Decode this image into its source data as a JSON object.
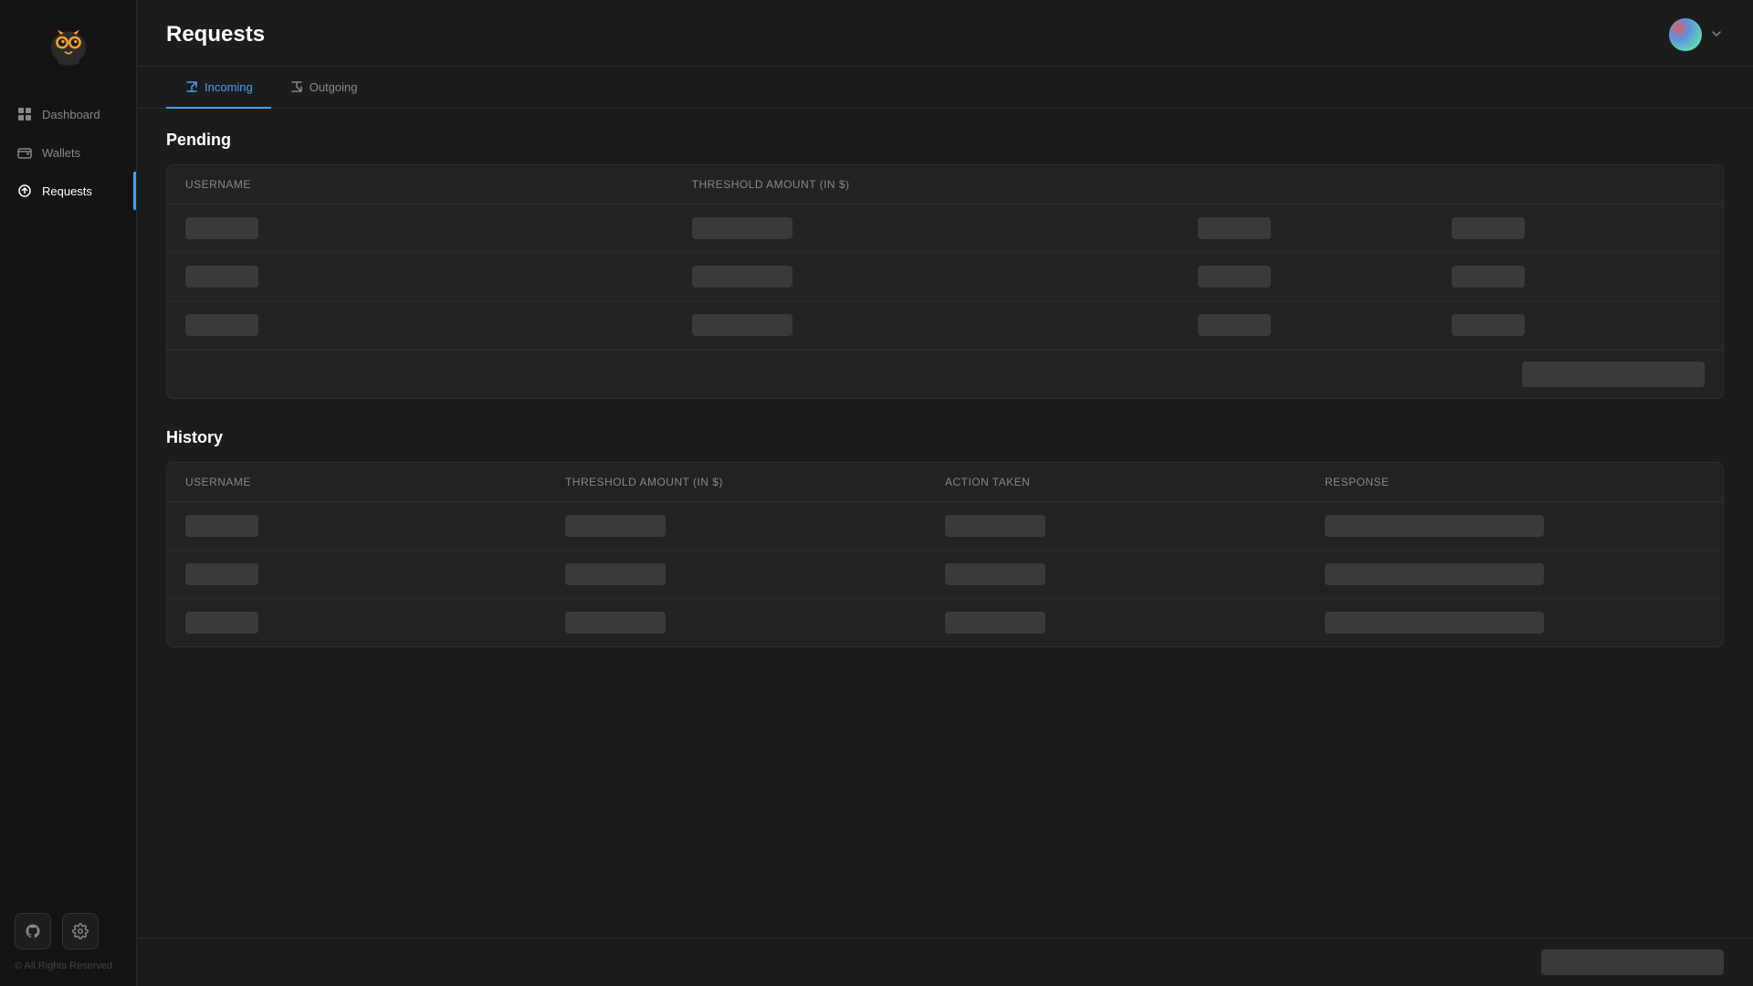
{
  "sidebar": {
    "logo_alt": "Owl Logo",
    "nav_items": [
      {
        "id": "dashboard",
        "label": "Dashboard",
        "icon": "grid-icon",
        "active": false
      },
      {
        "id": "wallets",
        "label": "Wallets",
        "icon": "wallet-icon",
        "active": false
      },
      {
        "id": "requests",
        "label": "Requests",
        "icon": "requests-icon",
        "active": true
      }
    ],
    "footer": {
      "copyright": "© All Rights Reserved",
      "github_icon": "github-icon",
      "settings_icon": "settings-icon"
    }
  },
  "header": {
    "title": "Requests",
    "avatar_alt": "User Avatar"
  },
  "tabs": [
    {
      "id": "incoming",
      "label": "Incoming",
      "active": true
    },
    {
      "id": "outgoing",
      "label": "Outgoing",
      "active": false
    }
  ],
  "pending": {
    "section_title": "Pending",
    "columns": [
      "Username",
      "Threshold Amount (in $)",
      "",
      ""
    ],
    "rows": [
      {
        "username_skeleton": true,
        "amount_skeleton": true,
        "action1_skeleton": true,
        "action2_skeleton": true
      },
      {
        "username_skeleton": true,
        "amount_skeleton": true,
        "action1_skeleton": true,
        "action2_skeleton": true
      },
      {
        "username_skeleton": true,
        "amount_skeleton": true,
        "action1_skeleton": true,
        "action2_skeleton": true
      }
    ]
  },
  "history": {
    "section_title": "History",
    "columns": [
      "Username",
      "Threshold Amount (in $)",
      "Action Taken",
      "Response"
    ],
    "rows": [
      {
        "username_skeleton": true,
        "amount_skeleton": true,
        "action_skeleton": true,
        "response_skeleton": true
      },
      {
        "username_skeleton": true,
        "amount_skeleton": true,
        "action_skeleton": true,
        "response_skeleton": true
      },
      {
        "username_skeleton": true,
        "amount_skeleton": true,
        "action_skeleton": true,
        "response_skeleton": true
      }
    ]
  }
}
